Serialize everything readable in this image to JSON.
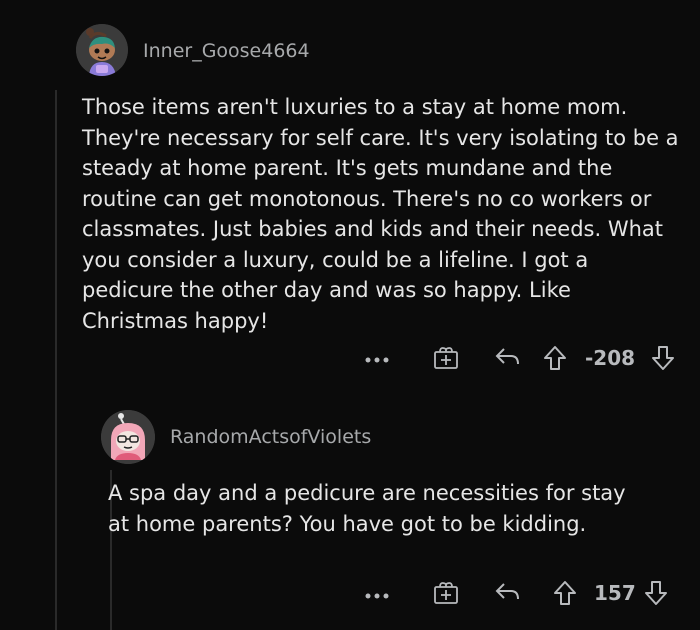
{
  "comments": [
    {
      "username": "Inner_Goose4664",
      "avatar": "snoo-avatar-girl-teal-hair",
      "body": "Those items aren't luxuries to a stay at home mom. They're necessary for self care. It's very isolating to be a steady at home parent. It's gets mundane and the routine can get monotonous. There's no co workers or classmates. Just babies and kids and their needs. What you consider a luxury, could be a lifeline. I got a pedicure the other day and was so happy. Like Christmas happy!",
      "score": "-208",
      "more_label": "•••"
    },
    {
      "username": "RandomActsofViolets",
      "avatar": "snoo-avatar-pink-hood-glasses",
      "body": "A spa day and a pedicure are necessities for stay at home parents? You have got to be kidding.",
      "score": "157",
      "more_label": "•••"
    }
  ],
  "icons": {
    "more": "more-options-icon",
    "award": "award-gift-icon",
    "reply": "reply-arrow-icon",
    "upvote": "upvote-arrow-icon",
    "downvote": "downvote-arrow-icon"
  },
  "colors": {
    "background": "#0b0b0b",
    "text": "#e6e6e6",
    "meta": "#a7a9ab",
    "icon": "#b8babd"
  }
}
